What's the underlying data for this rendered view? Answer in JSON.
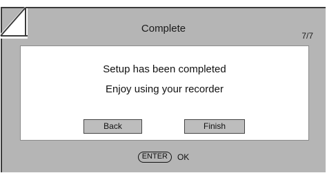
{
  "header": {
    "title": "Complete",
    "page_indicator": "7/7"
  },
  "dialog": {
    "message_line1": "Setup has been completed",
    "message_line2": "Enjoy using your recorder",
    "back_label": "Back",
    "finish_label": "Finish"
  },
  "footer": {
    "key_label": "ENTER",
    "action_label": "OK"
  },
  "colors": {
    "panel_background": "#b5b5b5",
    "dialog_background": "#ffffff",
    "button_background": "#bdbdbd",
    "border_dark": "#3a3a3a"
  }
}
